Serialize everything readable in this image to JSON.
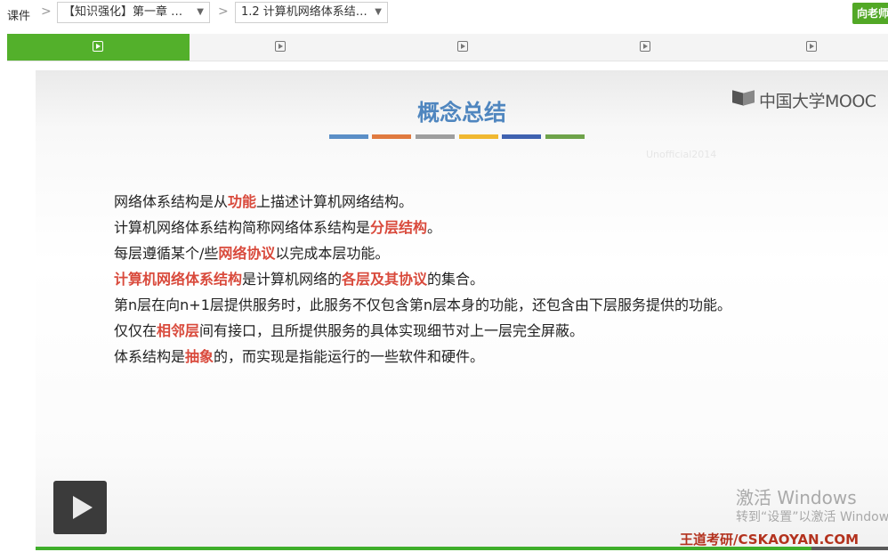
{
  "breadcrumb": {
    "root": "课件",
    "separator": ">",
    "chapter_select": "【知识强化】第一章 …",
    "section_select": "1.2 计算机网络体系结…",
    "ask_button": "向老师"
  },
  "tabs": [
    {
      "icon": "video-icon",
      "active": true
    },
    {
      "icon": "video-icon",
      "active": false
    },
    {
      "icon": "video-icon",
      "active": false
    },
    {
      "icon": "video-icon",
      "active": false
    },
    {
      "icon": "video-icon",
      "active": false
    }
  ],
  "slide": {
    "title": "概念总结",
    "logo_text": "中国大学MOOC",
    "faint_watermark": "Unofficial2014",
    "deco_colors": [
      "#5b8fc7",
      "#e07a3f",
      "#9e9e9e",
      "#f0b830",
      "#3f62b0",
      "#6ea34a"
    ],
    "lines": [
      [
        {
          "t": "网络体系结构是从"
        },
        {
          "t": "功能",
          "r": true
        },
        {
          "t": "上描述计算机网络结构。"
        }
      ],
      [
        {
          "t": "计算机网络体系结构简称网络体系结构是"
        },
        {
          "t": "分层结构",
          "r": true
        },
        {
          "t": "。"
        }
      ],
      [
        {
          "t": "每层遵循某个/些"
        },
        {
          "t": "网络协议",
          "r": true
        },
        {
          "t": "以完成本层功能。"
        }
      ],
      [
        {
          "t": "计算机网络体系结构",
          "r": true
        },
        {
          "t": "是计算机网络的"
        },
        {
          "t": "各层及其协议",
          "r": true
        },
        {
          "t": "的集合。"
        }
      ],
      [
        {
          "t": "第n层在向n+1层提供服务时，此服务不仅包含第n层本身的功能，还包含由下层服务提供的功能。"
        }
      ],
      [
        {
          "t": "仅仅在"
        },
        {
          "t": "相邻层",
          "r": true
        },
        {
          "t": "间有接口，且所提供服务的具体实现细节对上一层完全屏蔽。"
        }
      ],
      [
        {
          "t": "体系结构是"
        },
        {
          "t": "抽象",
          "r": true
        },
        {
          "t": "的，而实现是指能运行的一些软件和硬件。"
        }
      ]
    ]
  },
  "player": {
    "play_icon": "play-icon",
    "progress": 0.91,
    "accent_color": "#3fae2a"
  },
  "watermarks": {
    "windows_line1": "激活 Windows",
    "windows_line2": "转到“设置”以激活 Windows。",
    "wangdao": "王道考研/CSKAOYAN.COM"
  }
}
